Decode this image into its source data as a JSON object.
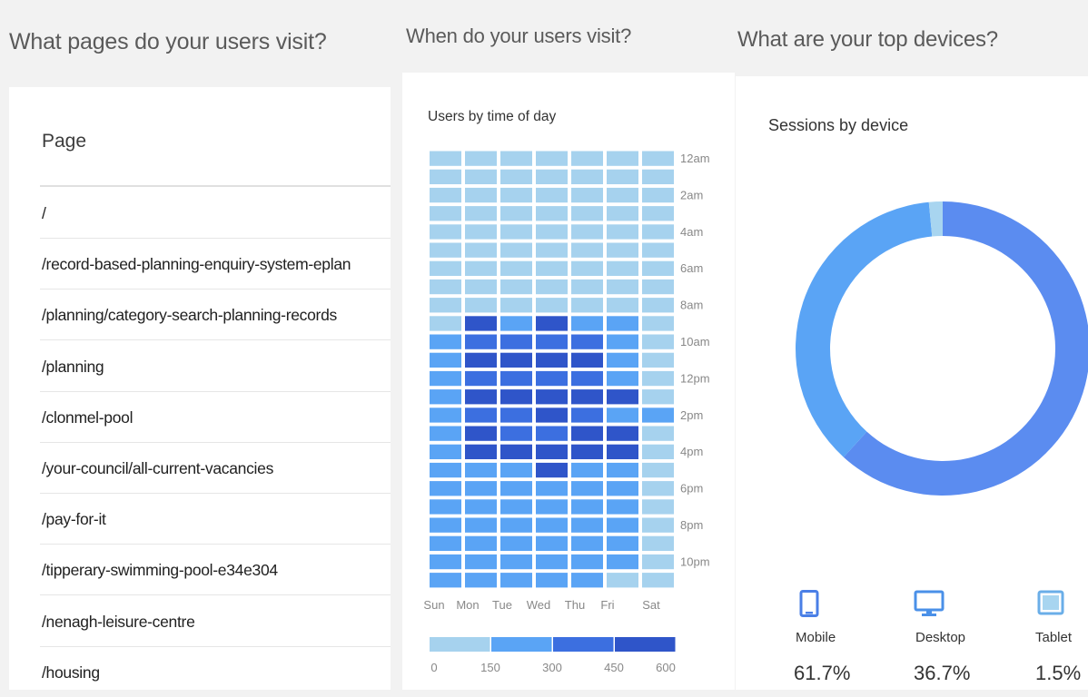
{
  "pages_section": {
    "title": "What pages do your users visit?",
    "column_header": "Page",
    "rows": [
      "/",
      "/record-based-planning-enquiry-system-eplan",
      "/planning/category-search-planning-records",
      "/planning",
      "/clonmel-pool",
      "/your-council/all-current-vacancies",
      "/pay-for-it",
      "/tipperary-swimming-pool-e34e304",
      "/nenagh-leisure-centre",
      "/housing"
    ]
  },
  "time_section": {
    "title": "When do your users visit?",
    "card_title": "Users by time of day"
  },
  "devices_section": {
    "title": "What are your top devices?",
    "card_title": "Sessions by device",
    "items": [
      {
        "label": "Mobile",
        "value": "61.7%",
        "icon": "mobile-icon"
      },
      {
        "label": "Desktop",
        "value": "36.7%",
        "icon": "desktop-icon"
      },
      {
        "label": "Tablet",
        "value": "1.5%",
        "icon": "tablet-icon"
      }
    ],
    "colors": {
      "mobile": "#5b8cf0",
      "desktop": "#5aa4f5",
      "tablet": "#a8d5f0"
    }
  },
  "chart_data": [
    {
      "type": "heatmap",
      "title": "Users by time of day",
      "x": [
        "Sun",
        "Mon",
        "Tue",
        "Wed",
        "Thu",
        "Fri",
        "Sat"
      ],
      "y_ticks": [
        "12am",
        "2am",
        "4am",
        "6am",
        "8am",
        "10am",
        "12pm",
        "2pm",
        "4pm",
        "6pm",
        "8pm",
        "10pm"
      ],
      "scale_ticks": [
        "0",
        "150",
        "300",
        "450",
        "600"
      ],
      "scale_colors": [
        "#a6d2ee",
        "#5aa4f5",
        "#3c6fe0",
        "#2f55c9"
      ],
      "levels": [
        [
          0,
          0,
          0,
          0,
          0,
          0,
          0
        ],
        [
          0,
          0,
          0,
          0,
          0,
          0,
          0
        ],
        [
          0,
          0,
          0,
          0,
          0,
          0,
          0
        ],
        [
          0,
          0,
          0,
          0,
          0,
          0,
          0
        ],
        [
          0,
          0,
          0,
          0,
          0,
          0,
          0
        ],
        [
          0,
          0,
          0,
          0,
          0,
          0,
          0
        ],
        [
          0,
          0,
          0,
          0,
          0,
          0,
          0
        ],
        [
          0,
          0,
          0,
          0,
          0,
          0,
          0
        ],
        [
          0,
          0,
          0,
          0,
          0,
          0,
          0
        ],
        [
          0,
          3,
          1,
          3,
          1,
          1,
          0
        ],
        [
          1,
          2,
          2,
          2,
          2,
          1,
          0
        ],
        [
          1,
          3,
          3,
          3,
          3,
          1,
          0
        ],
        [
          1,
          2,
          2,
          2,
          2,
          1,
          0
        ],
        [
          1,
          3,
          3,
          3,
          3,
          3,
          0
        ],
        [
          1,
          2,
          2,
          3,
          2,
          1,
          1
        ],
        [
          1,
          3,
          2,
          2,
          3,
          3,
          0
        ],
        [
          1,
          3,
          3,
          3,
          3,
          3,
          0
        ],
        [
          1,
          1,
          1,
          3,
          1,
          1,
          0
        ],
        [
          1,
          1,
          1,
          1,
          1,
          1,
          0
        ],
        [
          1,
          1,
          1,
          1,
          1,
          1,
          0
        ],
        [
          1,
          1,
          1,
          1,
          1,
          1,
          0
        ],
        [
          1,
          1,
          1,
          1,
          1,
          1,
          0
        ],
        [
          1,
          1,
          1,
          1,
          1,
          1,
          0
        ],
        [
          1,
          1,
          1,
          1,
          1,
          0,
          0
        ]
      ]
    },
    {
      "type": "pie",
      "title": "Sessions by device",
      "labels": [
        "Mobile",
        "Desktop",
        "Tablet"
      ],
      "values": [
        61.7,
        36.7,
        1.5
      ],
      "colors": [
        "#5b8cf0",
        "#5aa4f5",
        "#a8d5f0"
      ]
    }
  ]
}
